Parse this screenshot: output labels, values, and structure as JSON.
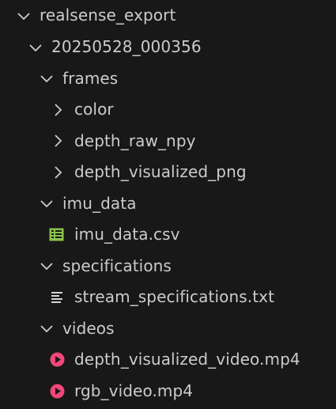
{
  "explorer": {
    "items": [
      {
        "label": "realsense_export",
        "kind": "folder",
        "state": "expanded",
        "depth": 0
      },
      {
        "label": "20250528_000356",
        "kind": "folder",
        "state": "expanded",
        "depth": 1
      },
      {
        "label": "frames",
        "kind": "folder",
        "state": "expanded",
        "depth": 2
      },
      {
        "label": "color",
        "kind": "folder",
        "state": "collapsed",
        "depth": 3
      },
      {
        "label": "depth_raw_npy",
        "kind": "folder",
        "state": "collapsed",
        "depth": 3
      },
      {
        "label": "depth_visualized_png",
        "kind": "folder",
        "state": "collapsed",
        "depth": 3
      },
      {
        "label": "imu_data",
        "kind": "folder",
        "state": "expanded",
        "depth": 2
      },
      {
        "label": "imu_data.csv",
        "kind": "file",
        "icon": "csv-table-icon",
        "icon_color": "#8bc34a",
        "depth": 3
      },
      {
        "label": "specifications",
        "kind": "folder",
        "state": "expanded",
        "depth": 2
      },
      {
        "label": "stream_specifications.txt",
        "kind": "file",
        "icon": "text-lines-icon",
        "icon_color": "#d4d4d4",
        "depth": 3
      },
      {
        "label": "videos",
        "kind": "folder",
        "state": "expanded",
        "depth": 2
      },
      {
        "label": "depth_visualized_video.mp4",
        "kind": "file",
        "icon": "play-video-icon",
        "icon_color": "#f0487a",
        "depth": 3
      },
      {
        "label": "rgb_video.mp4",
        "kind": "file",
        "icon": "play-video-icon",
        "icon_color": "#f0487a",
        "depth": 3
      }
    ]
  }
}
